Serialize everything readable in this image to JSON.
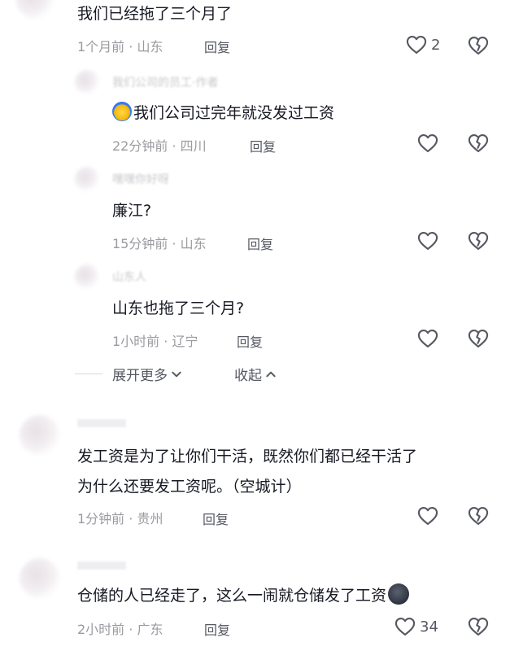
{
  "comments": [
    {
      "text": "我们已经拖了三个月了",
      "time": "1个月前",
      "location": "山东",
      "reply_label": "回复",
      "like_count": "2"
    }
  ],
  "replies": [
    {
      "author": "我们公司的员工·作者",
      "text": "我们公司过完年就没发过工资",
      "time": "22分钟前",
      "location": "四川",
      "reply_label": "回复",
      "emoji": "blue-face-emoji"
    },
    {
      "author": "嘿嘿你好呀",
      "text": "廉江?",
      "time": "15分钟前",
      "location": "山东",
      "reply_label": "回复"
    },
    {
      "author": "山东人",
      "text": "山东也拖了三个月?",
      "time": "1小时前",
      "location": "辽宁",
      "reply_label": "回复"
    }
  ],
  "thread_controls": {
    "expand_more": "展开更多",
    "collapse": "收起"
  },
  "comments_bottom": [
    {
      "text_line1": "发工资是为了让你们干活，既然你们都已经干活了",
      "text_line2": "为什么还要发工资呢。（空城计）",
      "time": "1分钟前",
      "location": "贵州",
      "reply_label": "回复"
    },
    {
      "text": "仓储的人已经走了，这么一闹就仓储发了工资",
      "time": "2小时前",
      "location": "广东",
      "reply_label": "回复",
      "like_count": "34",
      "emoji": "new-moon-face-emoji"
    }
  ],
  "colors": {
    "text": "#161823",
    "meta": "#9a9ba0",
    "icon": "#555861"
  }
}
